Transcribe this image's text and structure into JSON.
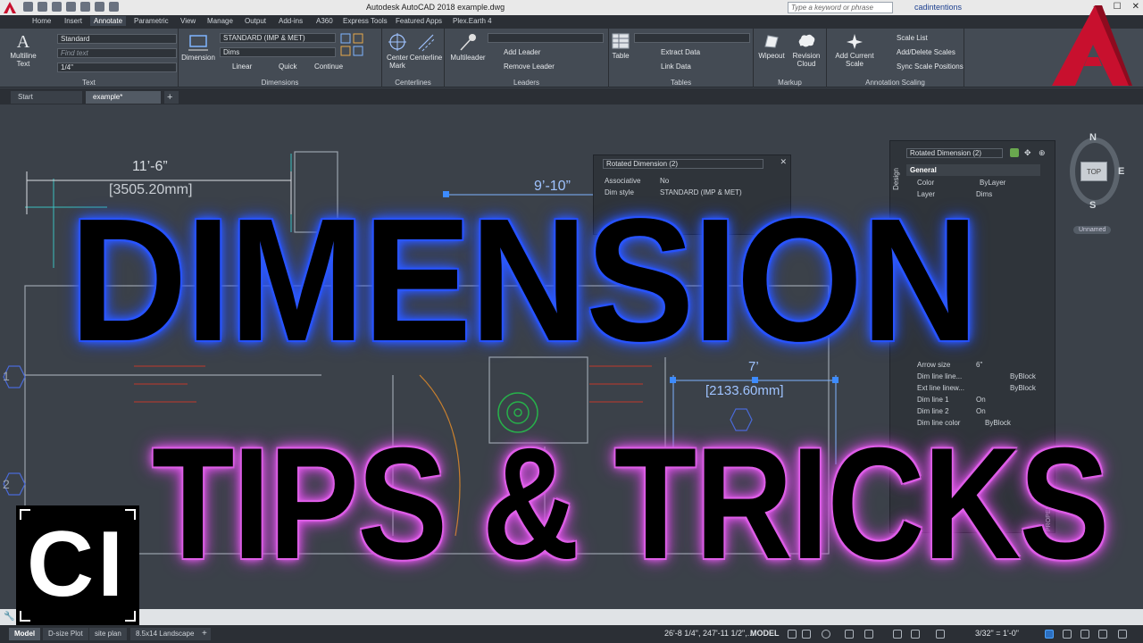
{
  "title_bar": {
    "app_title": "Autodesk AutoCAD 2018   example.dwg",
    "search_placeholder": "Type a keyword or phrase",
    "user_name": "cadintentions"
  },
  "menu_tabs": [
    "Home",
    "Insert",
    "Annotate",
    "Parametric",
    "View",
    "Manage",
    "Output",
    "Add-ins",
    "A360",
    "Express Tools",
    "Featured Apps",
    "Plex.Earth 4"
  ],
  "ribbon": {
    "text_panel": {
      "multiline_text": "Multiline Text",
      "style_value": "Standard",
      "find_placeholder": "Find text",
      "height_value": "1/4\"",
      "label": "Text"
    },
    "dimensions_panel": {
      "dimension_button": "Dimension",
      "style_value": "STANDARD (IMP & MET)",
      "layer_value": "Dims",
      "linear": "Linear",
      "quick": "Quick",
      "continue": "Continue",
      "label": "Dimensions"
    },
    "centerlines_panel": {
      "center_mark": "Center Mark",
      "centerline": "Centerline",
      "label": "Centerlines"
    },
    "leaders_panel": {
      "multileader": "Multileader",
      "add_leader": "Add Leader",
      "remove_leader": "Remove Leader",
      "label": "Leaders"
    },
    "tables_panel": {
      "table": "Table",
      "extract_data": "Extract Data",
      "link_data": "Link Data",
      "label": "Tables"
    },
    "markup_panel": {
      "wipeout": "Wipeout",
      "revision_cloud": "Revision Cloud",
      "label": "Markup"
    },
    "annotation_scaling_panel": {
      "add_current_scale": "Add Current Scale",
      "scale_list": "Scale List",
      "add_delete_scales": "Add/Delete Scales",
      "sync_scale_positions": "Sync Scale Positions",
      "label": "Annotation Scaling"
    }
  },
  "doc_tabs": [
    "Start",
    "example*"
  ],
  "drawing": {
    "dim_top_left": "11’-6”",
    "dim_top_left_mm": "[3505.20mm]",
    "dim_top_mid": "9’-10”",
    "dim_right": "7’",
    "dim_right_mm": "[2133.60mm]",
    "row_markers": [
      "1",
      "2"
    ]
  },
  "quick_properties": {
    "title": "Rotated Dimension (2)",
    "rows": [
      {
        "key": "Associative",
        "value": "No"
      },
      {
        "key": "Dim style",
        "value": "STANDARD (IMP & MET)"
      }
    ]
  },
  "properties_palette": {
    "selection": "Rotated Dimension (2)",
    "side_tab": "Design",
    "section": "General",
    "vertical_label": "PROPERTIES",
    "rows": [
      {
        "key": "Color",
        "value": "ByLayer"
      },
      {
        "key": "Layer",
        "value": "Dims"
      },
      {
        "key": "Arrow size",
        "value": "6\""
      },
      {
        "key": "Dim line line...",
        "value": "ByBlock"
      },
      {
        "key": "Ext line linew...",
        "value": "ByBlock"
      },
      {
        "key": "Dim line 1",
        "value": "On"
      },
      {
        "key": "Dim line 2",
        "value": "On"
      },
      {
        "key": "Dim line color",
        "value": "ByBlock"
      }
    ]
  },
  "viewcube": {
    "top_label": "TOP",
    "north": "N",
    "east": "E",
    "south": "S",
    "wcs_label": "Unnamed"
  },
  "overlay": {
    "headline": "DIMENSION",
    "subline": "TIPS & TRICKS",
    "logo_text": "CI"
  },
  "layout_tabs": [
    "Model",
    "D-size Plot",
    "site plan",
    "8.5x14 Landscape"
  ],
  "status_bar": {
    "coordinates": "26'-8 1/4\", 247'-11 1/2\",...",
    "mode": "MODEL",
    "scale": "3/32\" = 1'-0\""
  },
  "colors": {
    "headline_glow": "#2a55ff",
    "subline_glow": "#e86bf0",
    "autocad_red": "#c8102e",
    "dim_color": "#d8dde2"
  }
}
